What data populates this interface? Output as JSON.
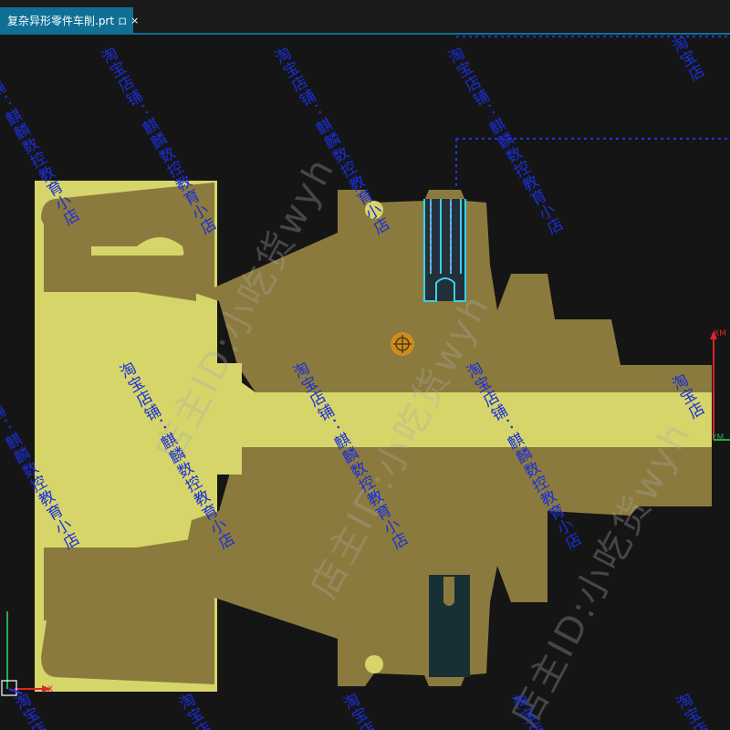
{
  "tab": {
    "title": "复杂异形零件车削.prt",
    "pin_glyph": "ロ",
    "close_glyph": "×"
  },
  "axes_right": {
    "xm_label": "XM",
    "ym_label": "YM"
  },
  "axes_triad": {
    "x_label": "X"
  },
  "watermarks": {
    "shop": "淘宝店铺：麒麟数控教育小店",
    "shop_partial": "淘宝店",
    "owner": "店主ID:小吃货wyh"
  },
  "colors": {
    "background": "#151515",
    "stock": "#d6d56a",
    "part": "#8b7a3d",
    "tab_active": "#0f6f95",
    "toolpath_cyan": "#3ad0e6",
    "dashed_line": "#2233ff",
    "watermark_text": "#1a2fd8",
    "axis_red": "#d8262b",
    "axis_green": "#2aa84a",
    "cursor_orange": "#d79018"
  }
}
